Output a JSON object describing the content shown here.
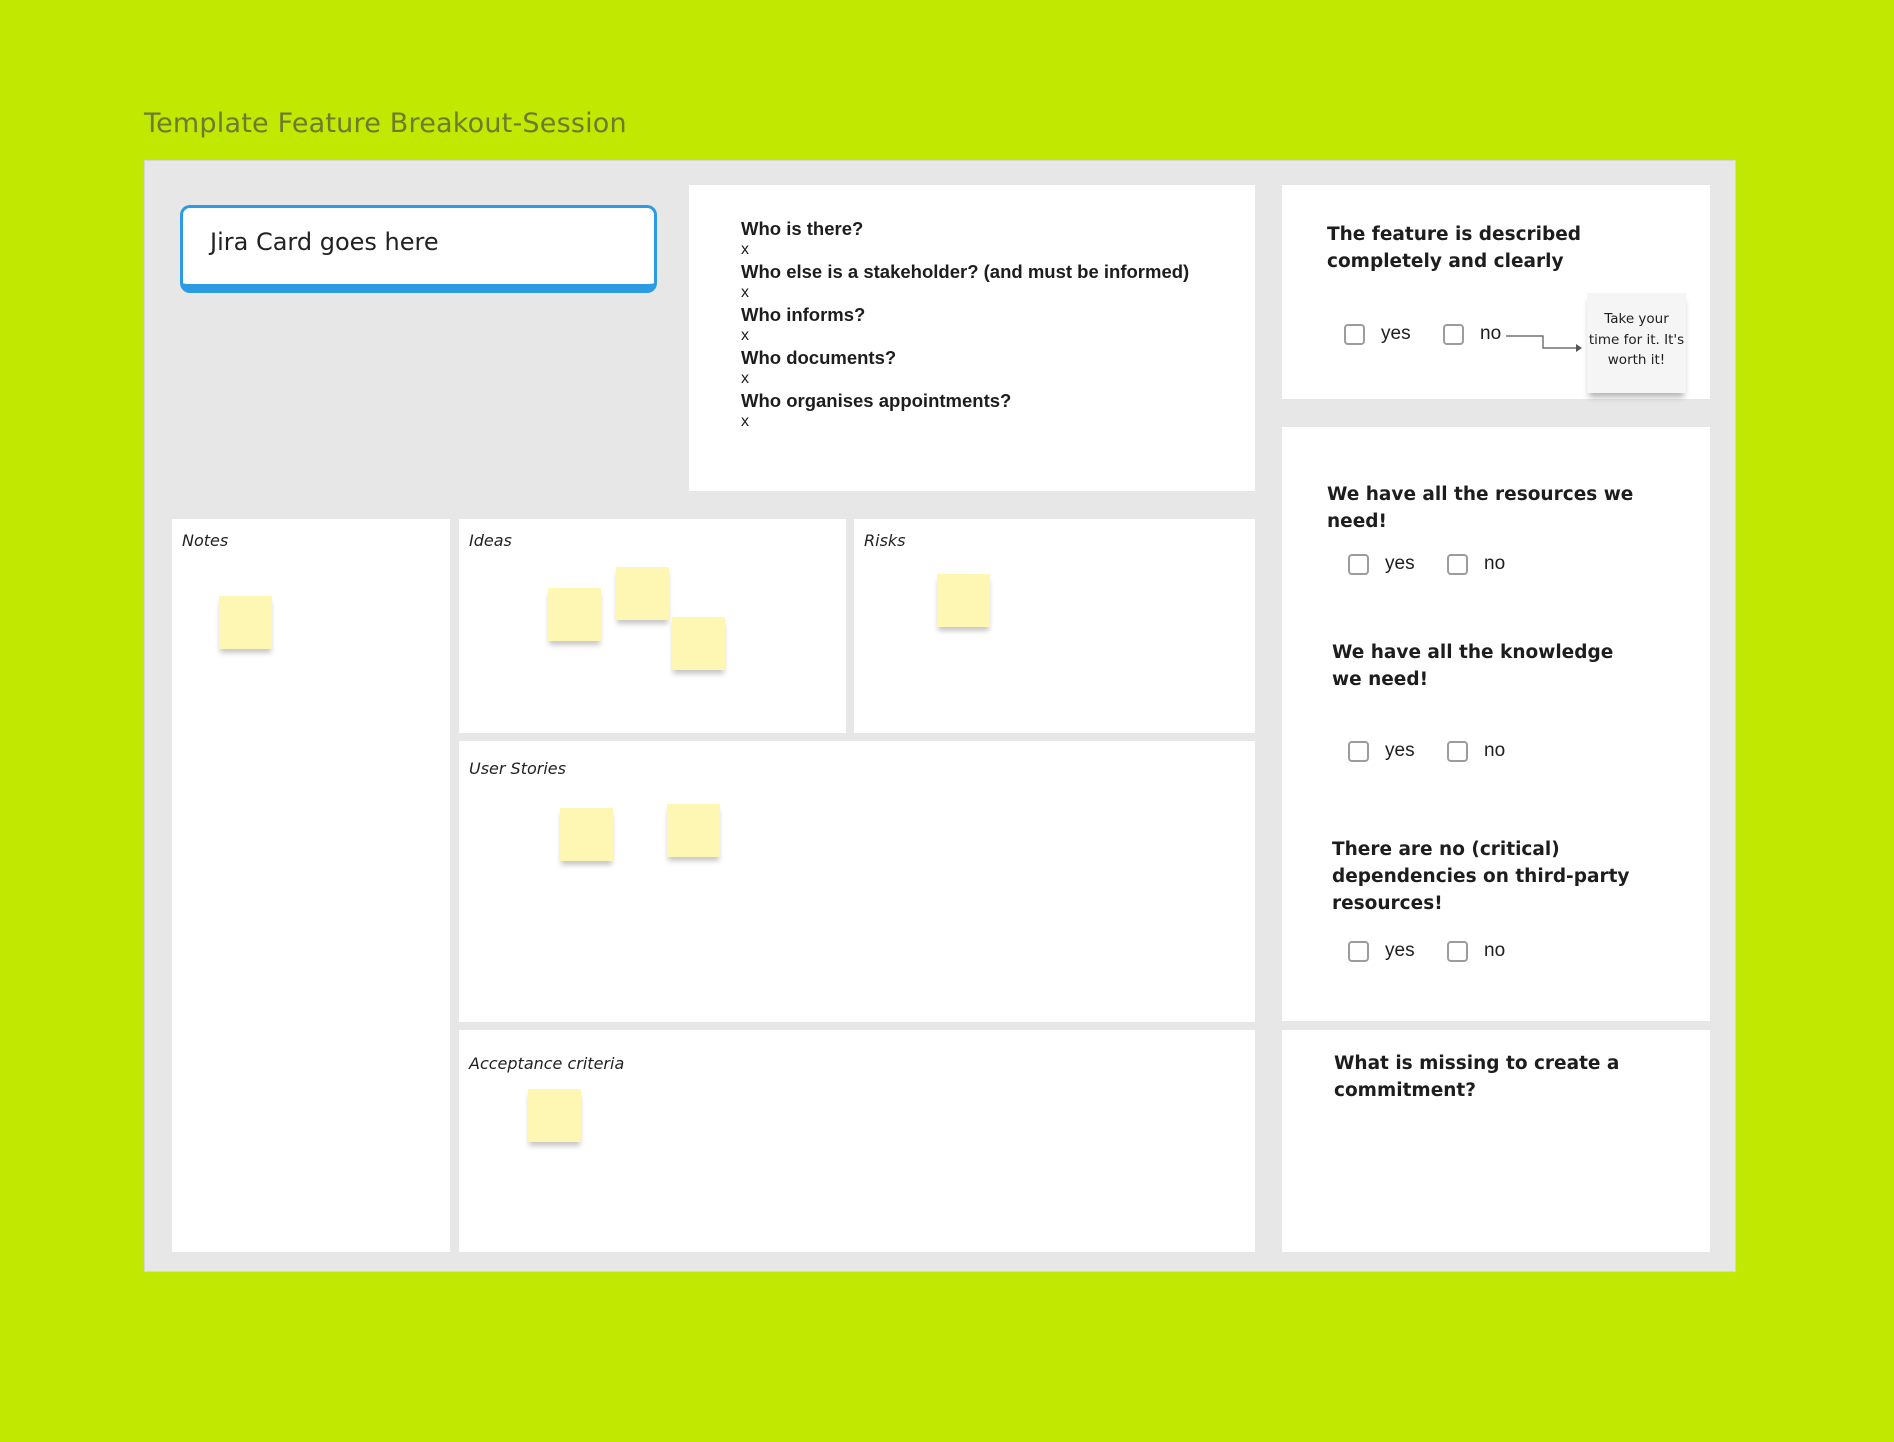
{
  "board": {
    "title": "Template Feature Breakout-Session"
  },
  "jira_card": {
    "text": "Jira Card goes here"
  },
  "roles": {
    "items": [
      {
        "question": "Who is there?",
        "answer": "x"
      },
      {
        "question": "Who else is a stakeholder? (and must be informed)",
        "answer": "x"
      },
      {
        "question": "Who informs?",
        "answer": "x"
      },
      {
        "question": "Who documents?",
        "answer": "x"
      },
      {
        "question": "Who organises appointments?",
        "answer": "x"
      }
    ]
  },
  "panels": {
    "notes": "Notes",
    "ideas": "Ideas",
    "risks": "Risks",
    "user_stories": "User Stories",
    "acceptance_criteria": "Acceptance criteria"
  },
  "checks": {
    "described": {
      "title": "The feature is described completely and clearly",
      "yes": "yes",
      "no": "no"
    },
    "resources": {
      "title": "We have all the resources we need!",
      "yes": "yes",
      "no": "no"
    },
    "knowledge": {
      "title": "We have all the knowledge we need!",
      "yes": "yes",
      "no": "no"
    },
    "dependencies": {
      "title": "There are no (critical) dependencies on third-party resources!",
      "yes": "yes",
      "no": "no"
    }
  },
  "tooltip": {
    "text": "Take your time for it. It's worth it!"
  },
  "missing": {
    "title": "What is missing to create a commitment?"
  },
  "colors": {
    "background": "#c0e800",
    "board": "#e7e7e7",
    "accent": "#2d9be3",
    "sticky": "#fdf7b3"
  }
}
